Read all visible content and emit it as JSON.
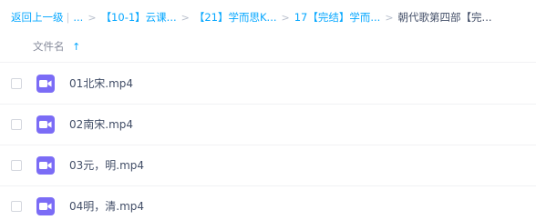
{
  "breadcrumb": {
    "back_label": "返回上一级",
    "ellipsis": "...",
    "items": [
      "【10-1】云课...",
      "【21】学而思K...",
      "17【完结】学而...",
      "朝代歌第四部【完..."
    ]
  },
  "list": {
    "header_label": "文件名"
  },
  "files": [
    {
      "name": "01北宋.mp4"
    },
    {
      "name": "02南宋.mp4"
    },
    {
      "name": "03元，明.mp4"
    },
    {
      "name": "04明，清.mp4"
    }
  ],
  "colors": {
    "link": "#06a7ff",
    "video_icon": "#7b6cf6"
  }
}
